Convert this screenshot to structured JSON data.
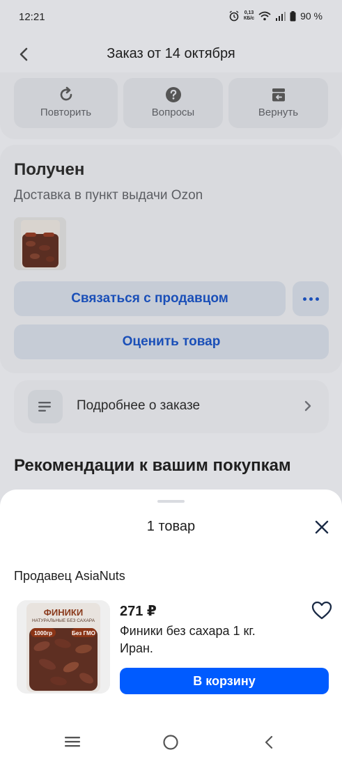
{
  "status_bar": {
    "time": "12:21",
    "net_speed_top": "0,13",
    "net_speed_bottom": "КБ/с",
    "battery": "90 %"
  },
  "header": {
    "title": "Заказ от 14 октября"
  },
  "actions": {
    "repeat": "Повторить",
    "questions": "Вопросы",
    "return": "Вернуть"
  },
  "order": {
    "status": "Получен",
    "delivery": "Доставка в пункт выдачи Ozon",
    "contact_seller": "Связаться с продавцом",
    "rate_product": "Оценить товар",
    "details": "Подробнее о заказе"
  },
  "recommendations_title": "Рекомендации к вашим покупкам",
  "sheet": {
    "title": "1 товар",
    "seller": "Продавец AsiaNuts",
    "product": {
      "price": "271 ₽",
      "name": "Финики без сахара 1 кг. Иран.",
      "pack_title": "ФИНИКИ",
      "pack_subtitle": "НАТУРАЛЬНЫЕ БЕЗ САХАРА",
      "pack_weight": "1000гр",
      "pack_badge": "Без ГМО"
    },
    "cart_button": "В корзину"
  },
  "colors": {
    "accent": "#005bff",
    "link_blue": "#1a4fb8",
    "overlay_bg": "#dedfe3"
  }
}
